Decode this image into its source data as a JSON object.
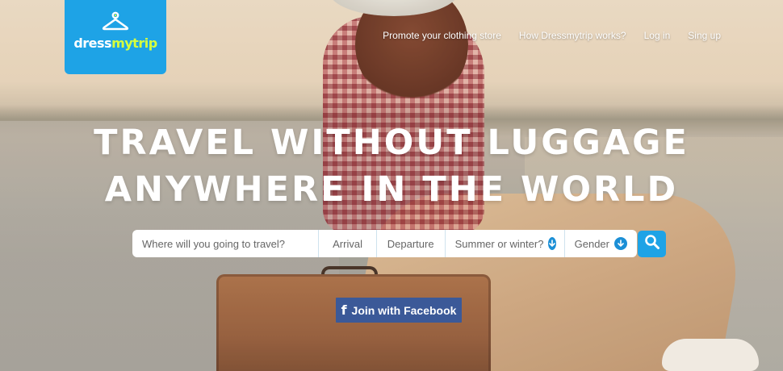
{
  "brand": {
    "name_part1": "dress",
    "name_part2": "mytrip",
    "color": "#1ea3e6",
    "accent": "#d6ff3e",
    "icon": "hanger-icon"
  },
  "nav": {
    "items": [
      {
        "label": "Promote your clothing store"
      },
      {
        "label": "How Dressmytrip works?"
      },
      {
        "label": "Log in"
      },
      {
        "label": "Sing up"
      }
    ]
  },
  "hero": {
    "headline_line1": "TRAVEL WITHOUT LUGGAGE",
    "headline_line2": "ANYWHERE IN THE WORLD"
  },
  "search": {
    "destination_placeholder": "Where will you going to travel?",
    "arrival_label": "Arrival",
    "departure_label": "Departure",
    "season_label": "Summer or winter?",
    "gender_label": "Gender",
    "search_icon": "search-icon",
    "dropdown_icon": "chevron-down-circle-icon"
  },
  "social": {
    "facebook_label": "Join with Facebook",
    "facebook_icon": "facebook-icon",
    "facebook_color": "#3b5998"
  }
}
